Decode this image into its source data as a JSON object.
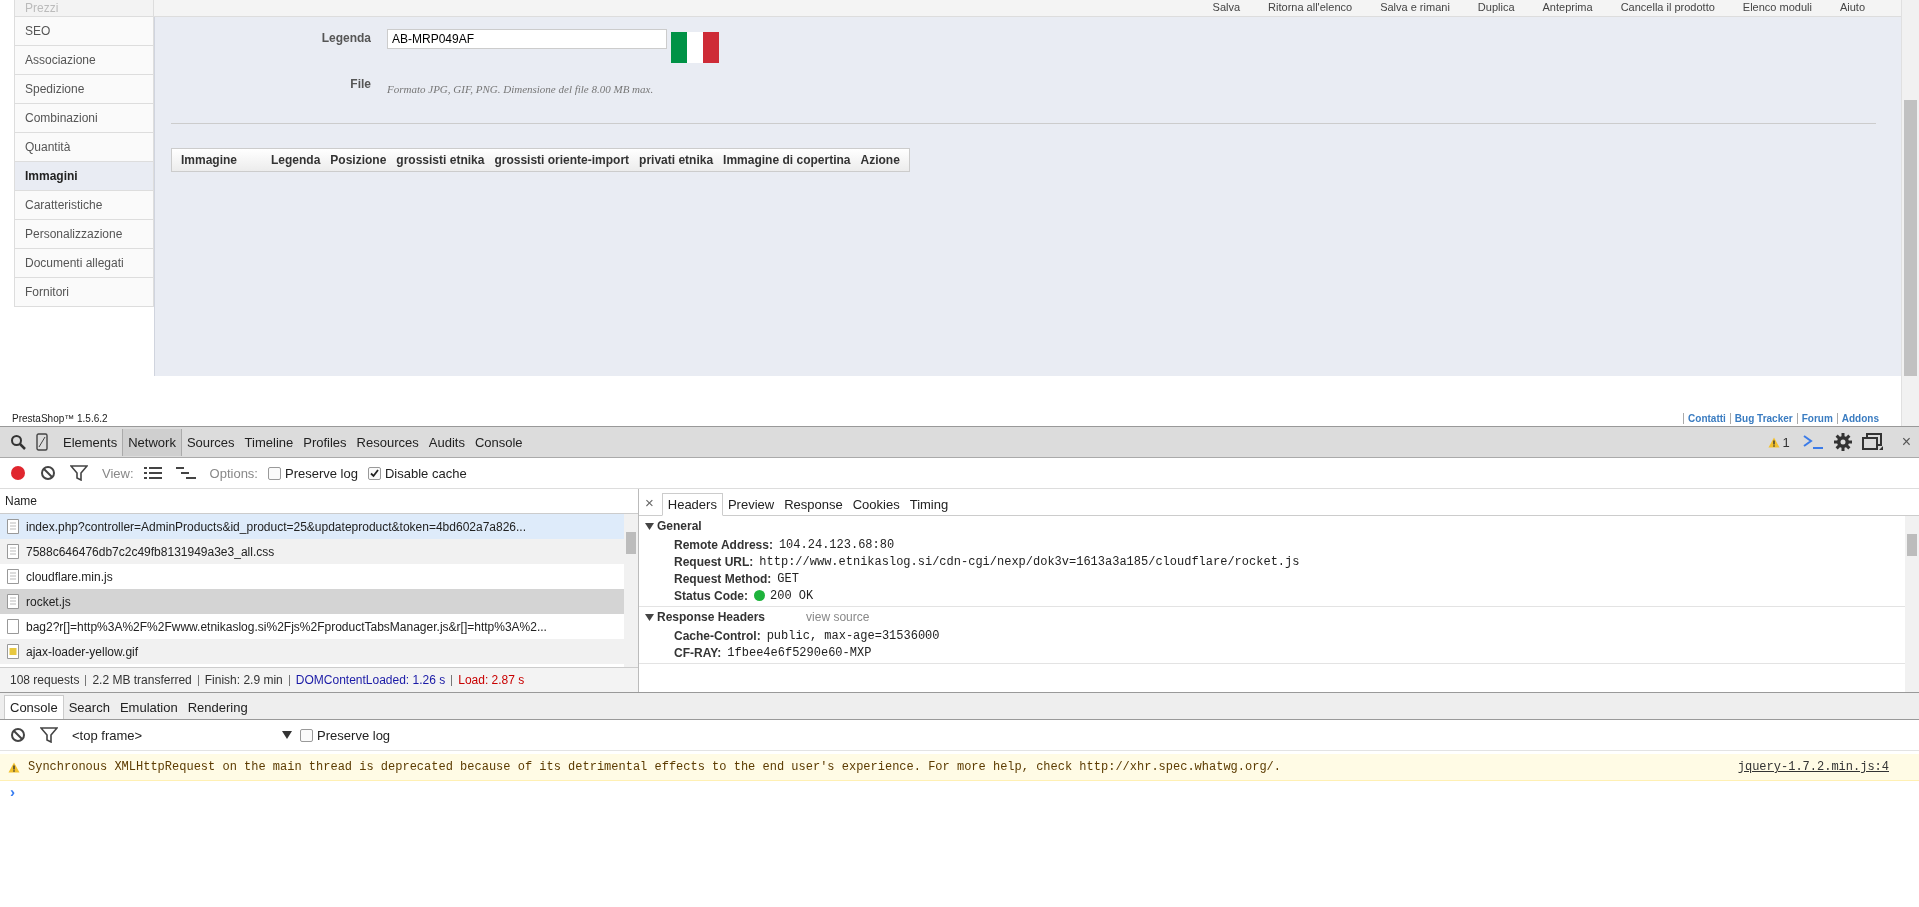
{
  "toolbar": {
    "buttons": [
      "Salva",
      "Ritorna all'elenco",
      "Salva e rimani",
      "Duplica",
      "Anteprima",
      "Cancella il prodotto",
      "Elenco moduli",
      "Aiuto"
    ]
  },
  "sidebar": {
    "items": [
      {
        "label": "Prezzi",
        "selected": false
      },
      {
        "label": "SEO",
        "selected": false
      },
      {
        "label": "Associazione",
        "selected": false
      },
      {
        "label": "Spedizione",
        "selected": false
      },
      {
        "label": "Combinazioni",
        "selected": false
      },
      {
        "label": "Quantità",
        "selected": false
      },
      {
        "label": "Immagini",
        "selected": true
      },
      {
        "label": "Caratteristiche",
        "selected": false
      },
      {
        "label": "Personalizzazione",
        "selected": false
      },
      {
        "label": "Documenti allegati",
        "selected": false
      },
      {
        "label": "Fornitori",
        "selected": false
      }
    ]
  },
  "form": {
    "legend_label": "Legenda",
    "legend_value": "AB-MRP049AF",
    "file_label": "File",
    "file_hint": "Formato JPG, GIF, PNG. Dimensione del file 8.00 MB max."
  },
  "images_table": {
    "columns": [
      "Immagine",
      "Legenda",
      "Posizione",
      "grossisti etnika",
      "grossisti oriente-import",
      "privati etnika",
      "Immagine di copertina",
      "Azione"
    ]
  },
  "footer": {
    "version": "PrestaShop™ 1.5.6.2",
    "links": [
      "Contatti",
      "Bug Tracker",
      "Forum",
      "Addons"
    ]
  },
  "devtools": {
    "tabs": [
      {
        "label": "Elements",
        "selected": false
      },
      {
        "label": "Network",
        "selected": true
      },
      {
        "label": "Sources",
        "selected": false
      },
      {
        "label": "Timeline",
        "selected": false
      },
      {
        "label": "Profiles",
        "selected": false
      },
      {
        "label": "Resources",
        "selected": false
      },
      {
        "label": "Audits",
        "selected": false
      },
      {
        "label": "Console",
        "selected": false
      }
    ],
    "warning_count": "1",
    "close": "×",
    "network_toolbar": {
      "view_label": "View:",
      "options_label": "Options:",
      "checkboxes": [
        {
          "label": "Preserve log",
          "checked": false
        },
        {
          "label": "Disable cache",
          "checked": true
        }
      ]
    },
    "requests": {
      "column": "Name",
      "rows": [
        {
          "name": "index.php?controller=AdminProducts&id_product=25&updateproduct&token=4bd602a7a826...",
          "kind": "document",
          "selected": false,
          "hovered": true
        },
        {
          "name": "7588c646476db7c2c49fb8131949a3e3_all.css",
          "kind": "document",
          "selected": false,
          "hovered": false
        },
        {
          "name": "cloudflare.min.js",
          "kind": "document",
          "selected": false,
          "hovered": false
        },
        {
          "name": "rocket.js",
          "kind": "document",
          "selected": true,
          "hovered": false
        },
        {
          "name": "bag2?r[]=http%3A%2F%2Fwww.etnikaslog.si%2Fjs%2FproductTabsManager.js&r[]=http%3A%2...",
          "kind": "blank",
          "selected": false,
          "hovered": false
        },
        {
          "name": "ajax-loader-yellow.gif",
          "kind": "image",
          "selected": false,
          "hovered": false
        }
      ]
    },
    "summary": [
      {
        "text": "108 requests",
        "color": "#333333"
      },
      {
        "text": "2.2 MB transferred",
        "color": "#333333"
      },
      {
        "text": "Finish: 2.9 min",
        "color": "#333333"
      },
      {
        "text": "DOMContentLoaded: 1.26 s",
        "color": "#1a1aa6"
      },
      {
        "text": "Load: 2.87 s",
        "color": "#c80000"
      }
    ],
    "detail_close": "×",
    "detail_tabs": [
      {
        "label": "Headers",
        "selected": true
      },
      {
        "label": "Preview",
        "selected": false
      },
      {
        "label": "Response",
        "selected": false
      },
      {
        "label": "Cookies",
        "selected": false
      },
      {
        "label": "Timing",
        "selected": false
      }
    ],
    "sections": [
      {
        "title": "General",
        "expanded": true,
        "rows": [
          {
            "key": "Remote Address:",
            "value": "104.24.123.68:80"
          },
          {
            "key": "Request URL:",
            "value": "http://www.etnikaslog.si/cdn-cgi/nexp/dok3v=1613a3a185/cloudflare/rocket.js"
          },
          {
            "key": "Request Method:",
            "value": "GET"
          },
          {
            "key": "Status Code:",
            "value": "200 OK",
            "kind": "status"
          }
        ]
      },
      {
        "title": "Response Headers",
        "expanded": true,
        "link": "view source",
        "rows": [
          {
            "key": "Cache-Control:",
            "value": "public, max-age=31536000"
          },
          {
            "key": "CF-RAY:",
            "value": "1fbee4e6f5290e60-MXP"
          }
        ]
      }
    ]
  },
  "drawer": {
    "tabs": [
      {
        "label": "Console",
        "selected": true
      },
      {
        "label": "Search",
        "selected": false
      },
      {
        "label": "Emulation",
        "selected": false
      },
      {
        "label": "Rendering",
        "selected": false
      }
    ],
    "frame": "<top frame>",
    "preserve_log": {
      "label": "Preserve log",
      "checked": false
    },
    "messages": [
      {
        "kind": "warning",
        "text": "Synchronous XMLHttpRequest on the main thread is deprecated because of its detrimental effects to the end user's experience. For more help, check http://xhr.spec.whatwg.org/.",
        "source": "jquery-1.7.2.min.js:4"
      }
    ],
    "prompt": "›"
  }
}
